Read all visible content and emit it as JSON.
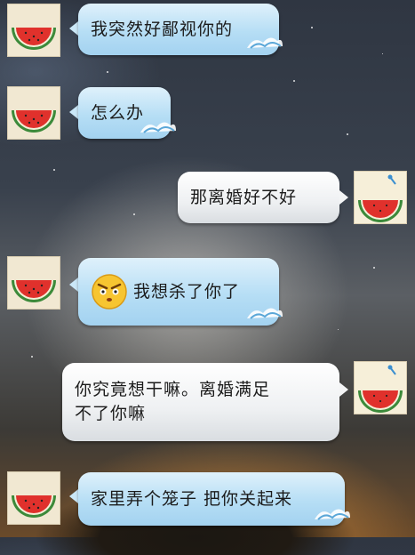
{
  "chat": {
    "messages": [
      {
        "side": "left",
        "text": "我突然好鄙视你的",
        "avatar_icon": "watermelon-icon"
      },
      {
        "side": "left",
        "text": "怎么办",
        "avatar_icon": "watermelon-icon"
      },
      {
        "side": "right",
        "text": "那离婚好不好",
        "avatar_icon": "watermelon-sticky-note-icon"
      },
      {
        "side": "left",
        "text": "我想杀了你了",
        "emoji": "angry-face-icon",
        "avatar_icon": "watermelon-icon"
      },
      {
        "side": "right",
        "text_line1": "你究竟想干嘛。离婚满足",
        "text_line2": "不了你嘛",
        "avatar_icon": "watermelon-sticky-note-icon"
      },
      {
        "side": "left",
        "text": "家里弄个笼子 把你关起来",
        "avatar_icon": "watermelon-icon"
      }
    ]
  },
  "colors": {
    "left_bubble": "#b6def5",
    "right_bubble": "#eef0f2",
    "watermelon_red": "#e0312c",
    "watermelon_rind": "#3c8a3a"
  }
}
